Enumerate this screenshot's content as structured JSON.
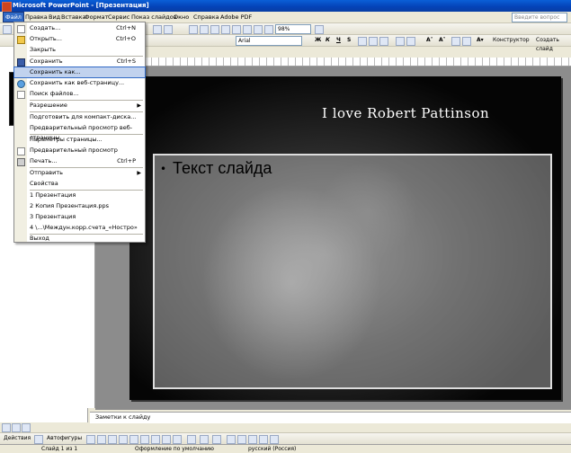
{
  "window": {
    "title": "Microsoft PowerPoint - [Презентация]"
  },
  "menubar": {
    "items": [
      "Файл",
      "Правка",
      "Вид",
      "Вставка",
      "Формат",
      "Сервис",
      "Показ слайдов",
      "Окно",
      "Справка",
      "Adobe PDF"
    ],
    "help_placeholder": "Введите вопрос"
  },
  "toolbar": {
    "zoom": "98%",
    "font": "Arial",
    "designer_label": "Конструктор",
    "new_slide_label": "Создать слайд"
  },
  "file_menu": {
    "items": [
      {
        "label": "Создать...",
        "shortcut": "Ctrl+N"
      },
      {
        "label": "Открыть...",
        "shortcut": "Ctrl+O"
      },
      {
        "label": "Закрыть",
        "shortcut": ""
      },
      {
        "label": "Сохранить",
        "shortcut": "Ctrl+S"
      },
      {
        "label": "Сохранить как...",
        "shortcut": ""
      },
      {
        "label": "Сохранить как веб-страницу...",
        "shortcut": ""
      },
      {
        "label": "Поиск файлов...",
        "shortcut": ""
      },
      {
        "label": "Разрешение",
        "shortcut": ""
      },
      {
        "label": "Подготовить для компакт-диска...",
        "shortcut": ""
      },
      {
        "label": "Предварительный просмотр веб-страницы",
        "shortcut": ""
      },
      {
        "label": "Параметры страницы...",
        "shortcut": ""
      },
      {
        "label": "Предварительный просмотр",
        "shortcut": ""
      },
      {
        "label": "Печать...",
        "shortcut": "Ctrl+P"
      },
      {
        "label": "Отправить",
        "shortcut": ""
      },
      {
        "label": "Свойства",
        "shortcut": ""
      },
      {
        "label": "1 Презентация",
        "shortcut": ""
      },
      {
        "label": "2 Копия Презентация.pps",
        "shortcut": ""
      },
      {
        "label": "3 Презентация",
        "shortcut": ""
      },
      {
        "label": "4 \\...\\Междун.корр.счета_«Ностро»",
        "shortcut": ""
      },
      {
        "label": "Выход",
        "shortcut": ""
      }
    ]
  },
  "slide": {
    "title": "I love Robert Pattinson",
    "body_text": "Текст слайда"
  },
  "notes": {
    "placeholder": "Заметки к слайду"
  },
  "drawing_toolbar": {
    "actions_label": "Действия",
    "autoshapes_label": "Автофигуры"
  },
  "status": {
    "slide_number": "Слайд 1 из 1",
    "design": "Оформление по умолчанию",
    "language": "русский (Россия)"
  },
  "colors": {
    "titlebar": "#0a5fd8",
    "menu_highlight": "#c1d2ee",
    "active_menu": "#316ac5"
  }
}
